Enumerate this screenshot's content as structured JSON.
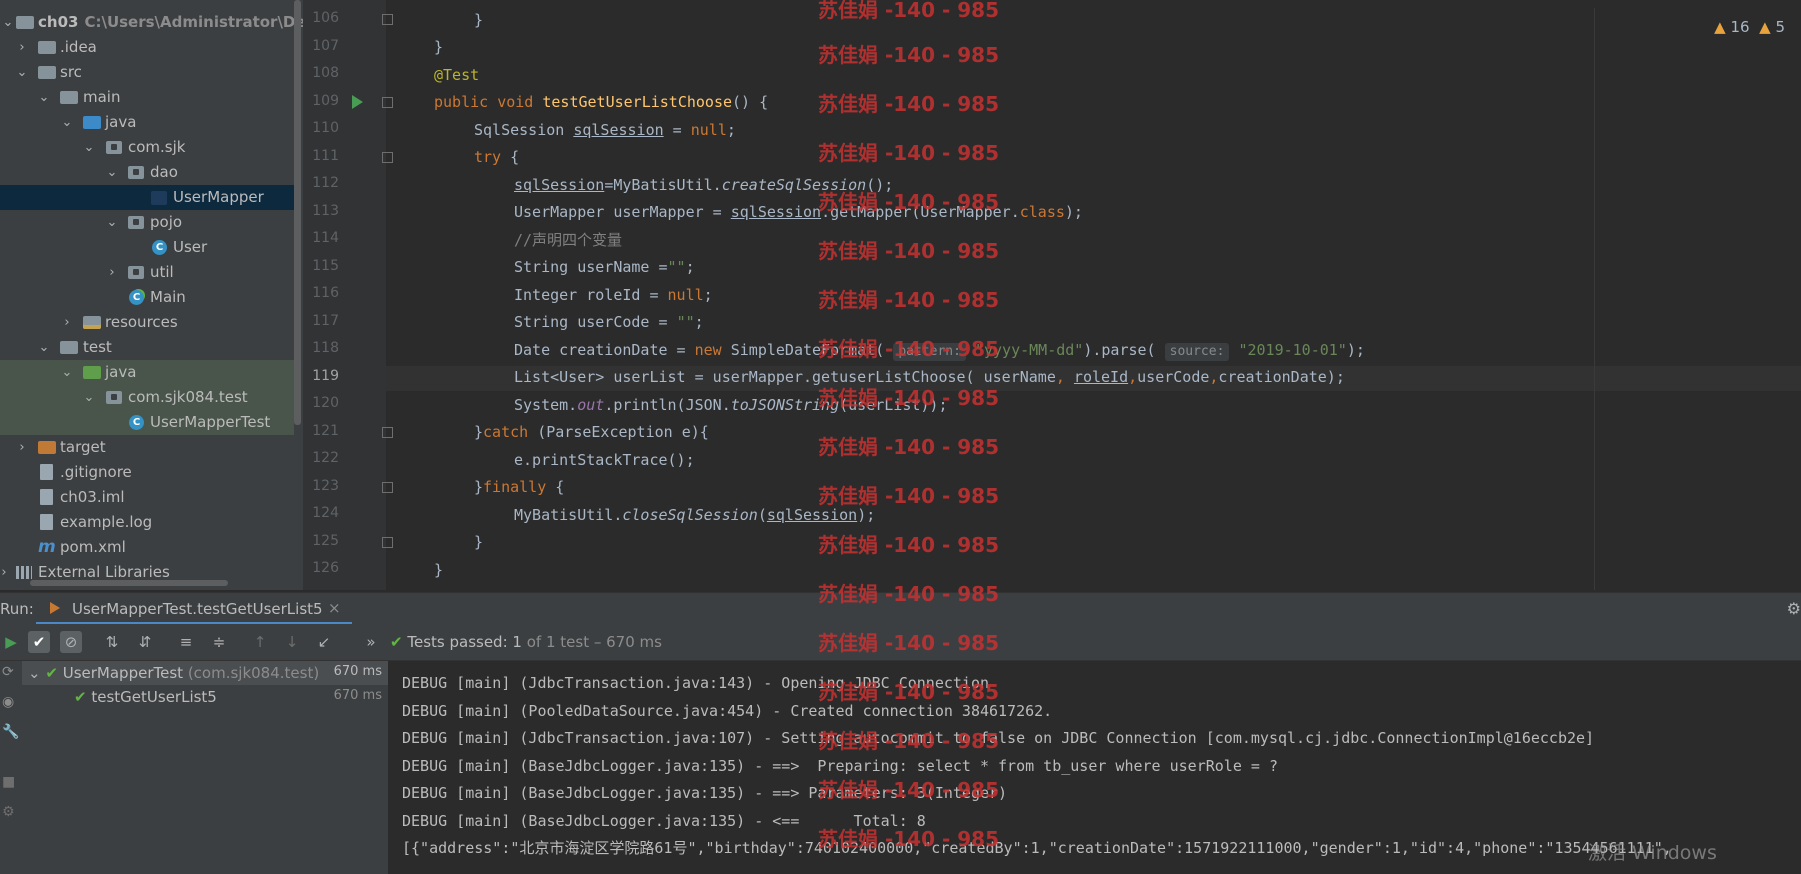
{
  "project": {
    "root_name": "ch03",
    "root_path": "C:\\Users\\Administrator\\Deskto",
    "items": [
      {
        "label": ".idea"
      },
      {
        "label": "src"
      },
      {
        "label": "main"
      },
      {
        "label": "java"
      },
      {
        "label": "com.sjk"
      },
      {
        "label": "dao"
      },
      {
        "label": "UserMapper"
      },
      {
        "label": "pojo"
      },
      {
        "label": "User"
      },
      {
        "label": "util"
      },
      {
        "label": "Main"
      },
      {
        "label": "resources"
      },
      {
        "label": "test"
      },
      {
        "label": "java"
      },
      {
        "label": "com.sjk084.test"
      },
      {
        "label": "UserMapperTest"
      },
      {
        "label": "target"
      },
      {
        "label": ".gitignore"
      },
      {
        "label": "ch03.iml"
      },
      {
        "label": "example.log"
      },
      {
        "label": "pom.xml"
      },
      {
        "label": "External Libraries"
      }
    ]
  },
  "editor": {
    "line_numbers": [
      "106",
      "107",
      "108",
      "109",
      "110",
      "111",
      "112",
      "113",
      "114",
      "115",
      "116",
      "117",
      "118",
      "119",
      "120",
      "121",
      "122",
      "123",
      "124",
      "125",
      "126"
    ],
    "current_line": "119",
    "warnings_count": "16",
    "weak_warnings_count": "5",
    "hint_pattern": "pattern:",
    "hint_source": "source:"
  },
  "run": {
    "label": "Run:",
    "tab_title": "UserMapperTest.testGetUserList5",
    "status_prefix": "Tests passed:",
    "status_count": "1",
    "status_suffix": "of 1 test – 670 ms",
    "tree": [
      {
        "name": "UserMapperTest",
        "detail": "(com.sjk084.test)",
        "time": "670 ms"
      },
      {
        "name": "testGetUserList5",
        "detail": "",
        "time": "670 ms"
      }
    ],
    "console_lines": [
      "DEBUG [main] (JdbcTransaction.java:143) - Opening JDBC Connection",
      "DEBUG [main] (PooledDataSource.java:454) - Created connection 384617262.",
      "DEBUG [main] (JdbcTransaction.java:107) - Setting autocommit to false on JDBC Connection [com.mysql.cj.jdbc.ConnectionImpl@16eccb2e]",
      "DEBUG [main] (BaseJdbcLogger.java:135) - ==>  Preparing: select * from tb_user where userRole = ?",
      "DEBUG [main] (BaseJdbcLogger.java:135) - ==> Parameters: 3(Integer)",
      "DEBUG [main] (BaseJdbcLogger.java:135) - <==      Total: 8",
      "[{\"address\":\"北京市海淀区学院路61号\",\"birthday\":740102400000,\"createdBy\":1,\"creationDate\":1571922111000,\"gender\":1,\"id\":4,\"phone\":\"13544561111\","
    ]
  },
  "watermark": "苏佳娟 -140 - 985",
  "windows_activation": "激活 Windows"
}
